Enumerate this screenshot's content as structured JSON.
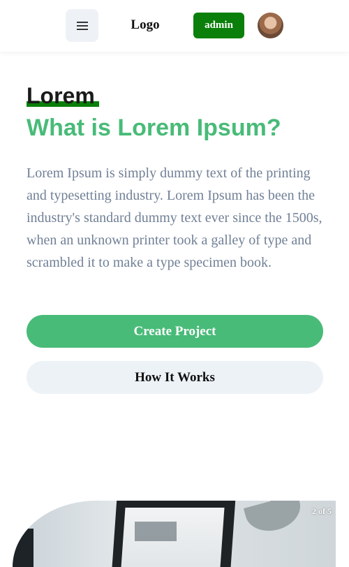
{
  "header": {
    "logo": "Logo",
    "admin_label": "admin",
    "menu_icon": "hamburger-icon"
  },
  "hero": {
    "kicker": "Lorem",
    "headline": "What is Lorem Ipsum?",
    "body": "Lorem Ipsum is simply dummy text of the printing and typesetting industry. Lorem Ipsum has been the industry's standard dummy text ever since the 1500s, when an unknown printer took a galley of type and scrambled it to make a type specimen book.",
    "primary_button": "Create Project",
    "secondary_button": "How It Works"
  },
  "carousel": {
    "counter": "2 of 5"
  },
  "colors": {
    "accent": "#48bb78",
    "admin": "#0a7f0a",
    "body_text": "#718096",
    "secondary_bg": "#edf2f7"
  }
}
